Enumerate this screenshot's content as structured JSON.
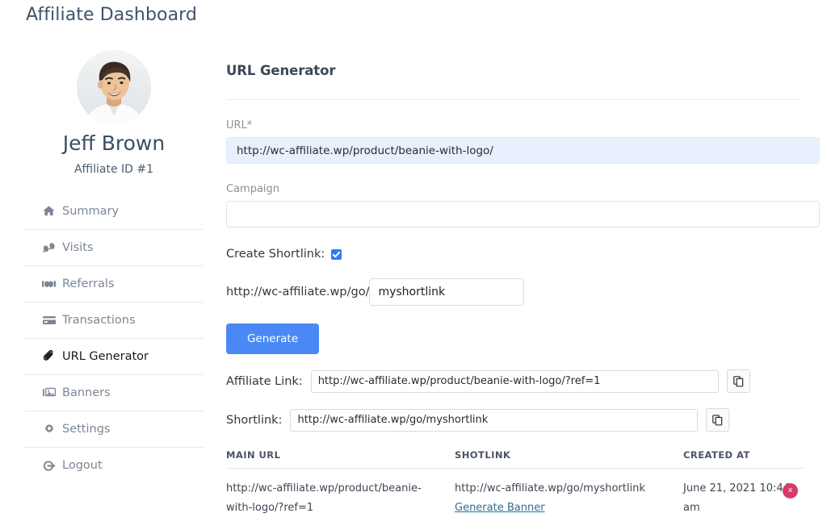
{
  "page": {
    "title": "Affiliate Dashboard"
  },
  "sidebar": {
    "avatar_alt": "user-photo",
    "profile_name": "Jeff Brown",
    "profile_id": "Affiliate ID #1",
    "items": [
      {
        "label": "Summary",
        "icon": "home-icon",
        "active": false
      },
      {
        "label": "Visits",
        "icon": "footprints-icon",
        "active": false
      },
      {
        "label": "Referrals",
        "icon": "handshake-icon",
        "active": false
      },
      {
        "label": "Transactions",
        "icon": "credit-card-icon",
        "active": false
      },
      {
        "label": "URL Generator",
        "icon": "paperclip-icon",
        "active": true
      },
      {
        "label": "Banners",
        "icon": "image-icon",
        "active": false
      },
      {
        "label": "Settings",
        "icon": "gear-icon",
        "active": false
      },
      {
        "label": "Logout",
        "icon": "logout-icon",
        "active": false
      }
    ]
  },
  "main": {
    "section_title": "URL Generator",
    "url_field": {
      "label": "URL*",
      "value": "http://wc-affiliate.wp/product/beanie-with-logo/",
      "placeholder": ""
    },
    "campaign_field": {
      "label": "Campaign",
      "value": "",
      "placeholder": ""
    },
    "shortlink": {
      "checkbox_label": "Create Shortlink:",
      "checked": true,
      "prefix": "http://wc-affiliate.wp/go/",
      "slug_value": "myshortlink",
      "slug_placeholder": ""
    },
    "generate_button": "Generate",
    "affiliate_link": {
      "label": "Affiliate Link:",
      "value": "http://wc-affiliate.wp/product/beanie-with-logo/?ref=1",
      "copy_icon": "copy-icon"
    },
    "shortlink_result": {
      "label": "Shortlink:",
      "value": "http://wc-affiliate.wp/go/myshortlink",
      "copy_icon": "copy-icon"
    },
    "table": {
      "headers": [
        "MAIN URL",
        "SHOTLINK",
        "CREATED AT"
      ],
      "rows": [
        {
          "main_url": "http://wc-affiliate.wp/product/beanie-with-logo/?ref=1",
          "shortlink": "http://wc-affiliate.wp/go/myshortlink",
          "shortlink_action": "Generate Banner",
          "created_at": "June 21, 2021 10:44 am",
          "delete_label": "x"
        }
      ]
    }
  },
  "colors": {
    "accent_blue": "#4a89f5",
    "checkbox_blue": "#2b7cf8",
    "delete_pink": "#d83a6b",
    "link_teal": "#2b6f8f",
    "autofill_bg": "#e8f0fe",
    "title_gray": "#41536b"
  }
}
